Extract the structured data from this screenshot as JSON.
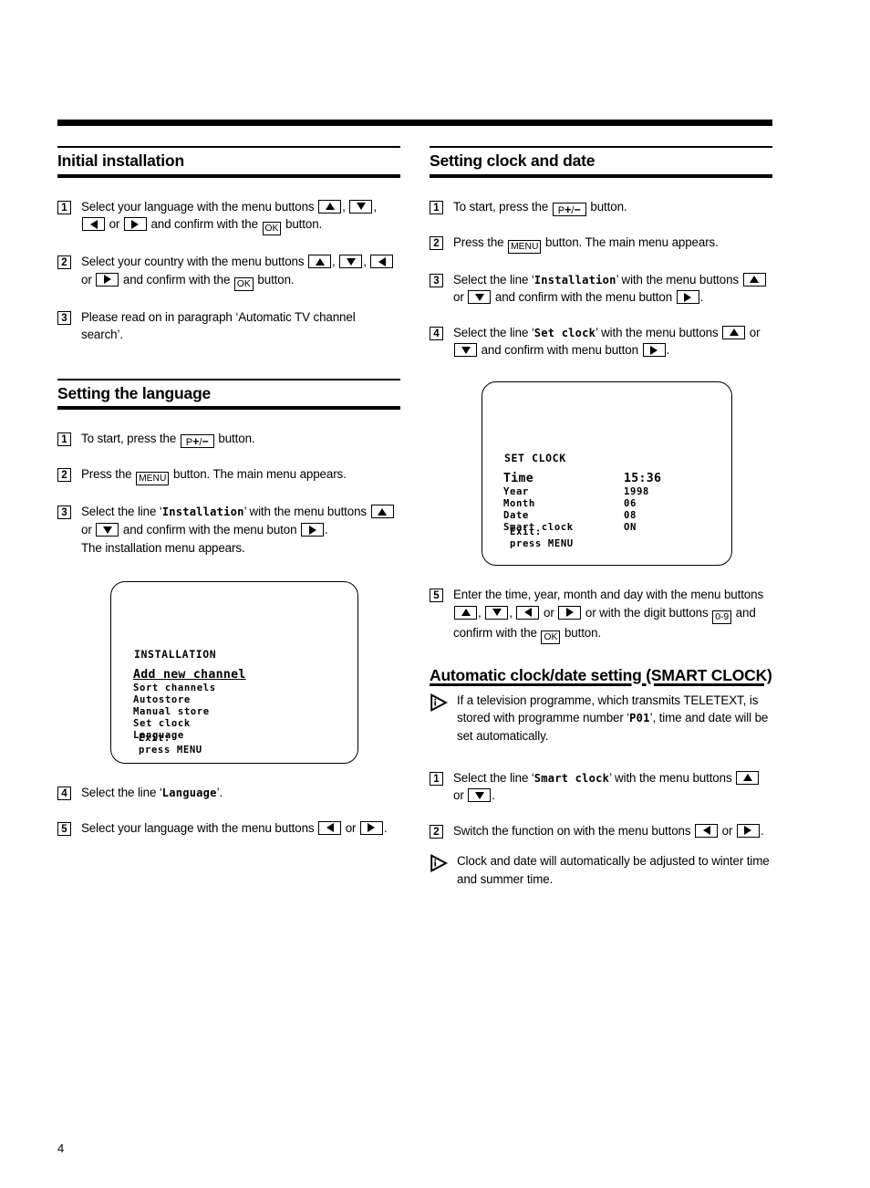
{
  "page": {
    "number": "4"
  },
  "left_column": {
    "sections": [
      {
        "id": "initial-installation",
        "title": "Initial installation",
        "steps": [
          {
            "num": "1",
            "parts": [
              {
                "t": "text",
                "v": "Select your language with the menu buttons "
              },
              {
                "t": "key",
                "v": "arrow-up"
              },
              {
                "t": "text",
                "v": ", "
              },
              {
                "t": "key",
                "v": "arrow-down"
              },
              {
                "t": "text",
                "v": ", "
              },
              {
                "t": "key",
                "v": "arrow-left"
              },
              {
                "t": "text",
                "v": " or "
              },
              {
                "t": "key",
                "v": "arrow-right"
              },
              {
                "t": "text",
                "v": " and confirm with the "
              },
              {
                "t": "key",
                "v": "OK"
              },
              {
                "t": "text",
                "v": " button."
              }
            ]
          },
          {
            "num": "2",
            "parts": [
              {
                "t": "text",
                "v": "Select your country with the menu buttons "
              },
              {
                "t": "key",
                "v": "arrow-up"
              },
              {
                "t": "text",
                "v": ", "
              },
              {
                "t": "key",
                "v": "arrow-down"
              },
              {
                "t": "text",
                "v": ", "
              },
              {
                "t": "key",
                "v": "arrow-left"
              },
              {
                "t": "text",
                "v": " or "
              },
              {
                "t": "key",
                "v": "arrow-right"
              },
              {
                "t": "text",
                "v": " and confirm with the "
              },
              {
                "t": "key",
                "v": "OK"
              },
              {
                "t": "text",
                "v": " button."
              }
            ]
          },
          {
            "num": "3",
            "parts": [
              {
                "t": "text",
                "v": "Please read on in paragraph ‘Automatic TV channel search’."
              }
            ]
          }
        ]
      },
      {
        "id": "setting-the-language",
        "title": "Setting the language",
        "steps": [
          {
            "num": "1",
            "parts": [
              {
                "t": "text",
                "v": "To start, press the "
              },
              {
                "t": "key",
                "v": "P+/-"
              },
              {
                "t": "text",
                "v": " button."
              }
            ]
          },
          {
            "num": "2",
            "parts": [
              {
                "t": "text",
                "v": "Press the "
              },
              {
                "t": "key",
                "v": "MENU"
              },
              {
                "t": "text",
                "v": " button. The main menu appears."
              }
            ]
          },
          {
            "num": "3",
            "parts": [
              {
                "t": "text",
                "v": "Select the line ‘"
              },
              {
                "t": "mono",
                "v": "Installation"
              },
              {
                "t": "text",
                "v": "’ with the menu buttons "
              },
              {
                "t": "key",
                "v": "arrow-up"
              },
              {
                "t": "text",
                "v": " or "
              },
              {
                "t": "key",
                "v": "arrow-down"
              },
              {
                "t": "text",
                "v": " and confirm with the menu buton "
              },
              {
                "t": "key",
                "v": "arrow-right"
              },
              {
                "t": "text",
                "v": "."
              },
              {
                "t": "br"
              },
              {
                "t": "text",
                "v": "The installation menu appears."
              }
            ]
          }
        ]
      }
    ],
    "installation_screen": {
      "title": "INSTALLATION",
      "highlighted_item": "Add new channel",
      "items": [
        "Sort channels",
        "Autostore",
        "Manual store",
        "Set clock",
        "Language"
      ],
      "exit_line1": "Exit:",
      "exit_line2": "press MENU"
    },
    "steps_after_screen": [
      {
        "num": "4",
        "parts": [
          {
            "t": "text",
            "v": "Select the line ‘"
          },
          {
            "t": "mono",
            "v": "Language"
          },
          {
            "t": "text",
            "v": "’."
          }
        ]
      },
      {
        "num": "5",
        "parts": [
          {
            "t": "text",
            "v": "Select your language with the menu buttons "
          },
          {
            "t": "key",
            "v": "arrow-left"
          },
          {
            "t": "text",
            "v": " or "
          },
          {
            "t": "key",
            "v": "arrow-right"
          },
          {
            "t": "text",
            "v": "."
          }
        ]
      }
    ]
  },
  "right_column": {
    "section_clock": {
      "id": "setting-clock-and-date",
      "title": "Setting clock and date",
      "steps": [
        {
          "num": "1",
          "parts": [
            {
              "t": "text",
              "v": "To start, press the "
            },
            {
              "t": "key",
              "v": "P+/-"
            },
            {
              "t": "text",
              "v": " button."
            }
          ]
        },
        {
          "num": "2",
          "parts": [
            {
              "t": "text",
              "v": "Press the "
            },
            {
              "t": "key",
              "v": "MENU"
            },
            {
              "t": "text",
              "v": " button. The main menu appears."
            }
          ]
        },
        {
          "num": "3",
          "parts": [
            {
              "t": "text",
              "v": "Select the line ‘"
            },
            {
              "t": "mono",
              "v": "Installation"
            },
            {
              "t": "text",
              "v": "’ with the menu buttons "
            },
            {
              "t": "key",
              "v": "arrow-up"
            },
            {
              "t": "text",
              "v": " or "
            },
            {
              "t": "key",
              "v": "arrow-down"
            },
            {
              "t": "text",
              "v": " and confirm with the menu button "
            },
            {
              "t": "key",
              "v": "arrow-right"
            },
            {
              "t": "text",
              "v": "."
            }
          ]
        },
        {
          "num": "4",
          "parts": [
            {
              "t": "text",
              "v": "Select the line ‘"
            },
            {
              "t": "mono",
              "v": "Set clock"
            },
            {
              "t": "text",
              "v": "’ with the menu buttons "
            },
            {
              "t": "key",
              "v": "arrow-up"
            },
            {
              "t": "text",
              "v": " or "
            },
            {
              "t": "key",
              "v": "arrow-down"
            },
            {
              "t": "text",
              "v": " and confirm with menu button "
            },
            {
              "t": "key",
              "v": "arrow-right"
            },
            {
              "t": "text",
              "v": "."
            }
          ]
        }
      ]
    },
    "set_clock_screen": {
      "title": "SET CLOCK",
      "highlighted_row": {
        "label": "Time",
        "value": "15:36"
      },
      "rows": [
        {
          "label": "Year",
          "value": "1998"
        },
        {
          "label": "Month",
          "value": "06"
        },
        {
          "label": "Date",
          "value": "08"
        },
        {
          "label": "Smart clock",
          "value": "ON"
        }
      ],
      "exit_line1": "Exit:",
      "exit_line2": "press MENU"
    },
    "step_after_screen": {
      "num": "5",
      "parts": [
        {
          "t": "text",
          "v": "Enter the time, year, month and day with the menu buttons "
        },
        {
          "t": "key",
          "v": "arrow-up"
        },
        {
          "t": "text",
          "v": ", "
        },
        {
          "t": "key",
          "v": "arrow-down"
        },
        {
          "t": "text",
          "v": ", "
        },
        {
          "t": "key",
          "v": "arrow-left"
        },
        {
          "t": "text",
          "v": " or "
        },
        {
          "t": "key",
          "v": "arrow-right"
        },
        {
          "t": "text",
          "v": " or with the digit buttons "
        },
        {
          "t": "key",
          "v": "0-9"
        },
        {
          "t": "text",
          "v": " and confirm with the "
        },
        {
          "t": "key",
          "v": "OK"
        },
        {
          "t": "text",
          "v": " button."
        }
      ]
    },
    "section_smart": {
      "id": "automatic-clock-date-setting",
      "title": "Automatic clock/date setting (SMART CLOCK)",
      "note_top": {
        "icon": "info-triangle",
        "parts": [
          {
            "t": "text",
            "v": "If a television programme, which transmits TELETEXT, is stored with programme number ‘"
          },
          {
            "t": "mono",
            "v": "P01"
          },
          {
            "t": "text",
            "v": "’, time and date will be set automatically."
          }
        ]
      },
      "steps": [
        {
          "num": "1",
          "parts": [
            {
              "t": "text",
              "v": "Select the line ‘"
            },
            {
              "t": "mono",
              "v": "Smart clock"
            },
            {
              "t": "text",
              "v": "’ with the menu buttons "
            },
            {
              "t": "key",
              "v": "arrow-up"
            },
            {
              "t": "text",
              "v": " or "
            },
            {
              "t": "key",
              "v": "arrow-down"
            },
            {
              "t": "text",
              "v": "."
            }
          ]
        },
        {
          "num": "2",
          "parts": [
            {
              "t": "text",
              "v": "Switch the function on with the menu buttons "
            },
            {
              "t": "key",
              "v": "arrow-left"
            },
            {
              "t": "text",
              "v": " or "
            },
            {
              "t": "key",
              "v": "arrow-right"
            },
            {
              "t": "text",
              "v": "."
            }
          ]
        }
      ],
      "note_bottom": {
        "icon": "info-triangle",
        "parts": [
          {
            "t": "text",
            "v": "Clock and date will automatically be adjusted to winter time and summer time."
          }
        ]
      }
    }
  }
}
